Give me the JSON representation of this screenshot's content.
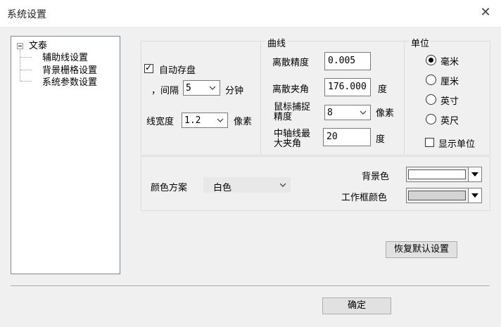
{
  "window": {
    "title": "系统设置",
    "close_icon": "close-icon"
  },
  "tree": {
    "root": "文泰",
    "items": [
      "辅助线设置",
      "背景栅格设置",
      "系统参数设置"
    ]
  },
  "autosave": {
    "checkbox_label": "自动存盘",
    "checked": true,
    "interval_label": "，间隔",
    "interval_value": "5",
    "interval_unit": "分钟"
  },
  "line_width": {
    "label": "线宽度",
    "value": "1.2",
    "unit": "像素"
  },
  "curve": {
    "group_title": "曲线",
    "precision_label": "离散精度",
    "precision_value": "0.005",
    "angle_label": "离散夹角",
    "angle_value": "176.000",
    "angle_unit": "度",
    "mouse_label_1": "鼠标捕捉",
    "mouse_label_2": "精度",
    "mouse_value": "8",
    "mouse_unit": "像素",
    "axis_label_1": "中轴线最",
    "axis_label_2": "大夹角",
    "axis_value": "20",
    "axis_unit": "度"
  },
  "unit": {
    "group_title": "单位",
    "options": [
      "毫米",
      "厘米",
      "英寸",
      "英尺"
    ],
    "selected": "毫米",
    "show_unit_label": "显示单位",
    "show_unit_checked": false
  },
  "color": {
    "scheme_label": "颜色方案",
    "scheme_value": "白色",
    "bg_label": "背景色",
    "bg_color": "#ffffff",
    "frame_label": "工作框颜色",
    "frame_color": "#d4d4d4"
  },
  "buttons": {
    "restore_defaults": "恢复默认设置",
    "ok": "确定"
  }
}
